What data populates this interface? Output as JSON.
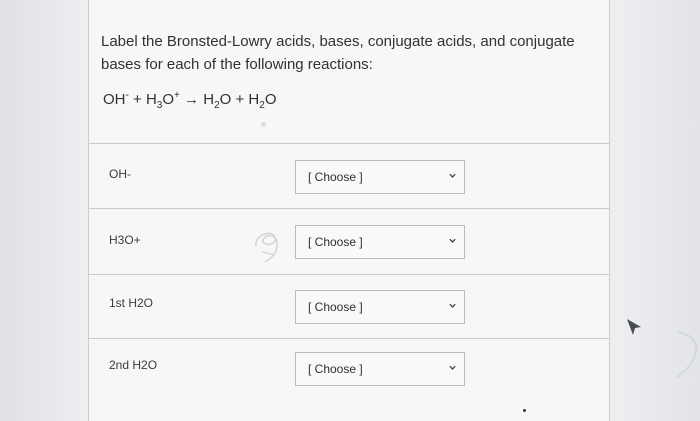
{
  "question": {
    "prompt": "Label the Bronsted-Lowry acids, bases, conjugate acids, and conjugate bases for each of the following reactions:",
    "equation": {
      "oh": "OH",
      "minus": "-",
      "plus1": "+",
      "h": "H",
      "three": "3",
      "o": "O",
      "plus_charge": "+",
      "arrow": "→",
      "h2o_a_h": "H",
      "h2o_a_two": "2",
      "h2o_a_o": "O",
      "plus2": "+",
      "h2o_b_h": "H",
      "h2o_b_two": "2",
      "h2o_b_o": "O"
    }
  },
  "rows": [
    {
      "label": "OH-",
      "select_value": "[ Choose ]"
    },
    {
      "label": "H3O+",
      "select_value": "[ Choose ]"
    },
    {
      "label": "1st H2O",
      "select_value": "[ Choose ]"
    },
    {
      "label": "2nd H2O",
      "select_value": "[ Choose ]"
    }
  ],
  "icons": {
    "select_caret": "chevron-down-icon",
    "cursor": "mouse-cursor-icon",
    "annotation": "pencil-annotation-icon"
  },
  "colors": {
    "page": "#f7f7f8",
    "text": "#2f3237",
    "border": "#b7bcc3",
    "divider": "#c7cbd0",
    "cursor": "#4a4d52"
  }
}
